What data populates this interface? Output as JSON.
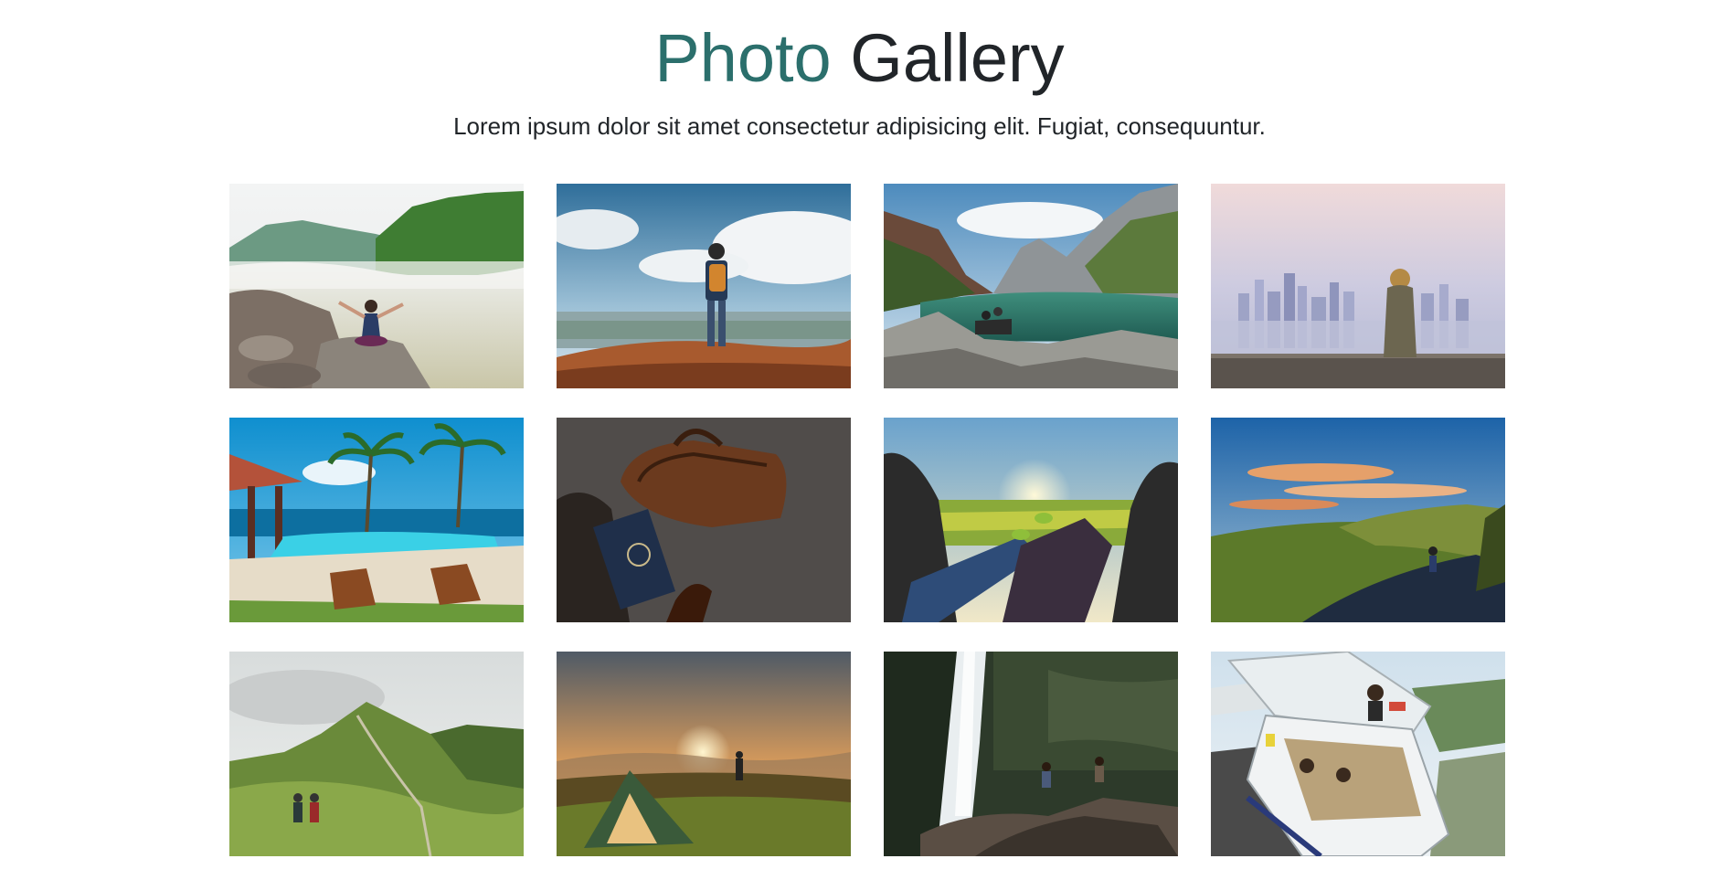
{
  "header": {
    "title_accent": "Photo",
    "title_rest": " Gallery",
    "subtitle": "Lorem ipsum dolor sit amet consectetur adipisicing elit. Fugiat, consequuntur."
  },
  "colors": {
    "accent": "#2b6f6c",
    "text": "#212529",
    "background": "#ffffff"
  },
  "gallery": {
    "photos": [
      {
        "name": "photo-river-meditation"
      },
      {
        "name": "photo-hiker-cliff"
      },
      {
        "name": "photo-mountain-lake"
      },
      {
        "name": "photo-city-view"
      },
      {
        "name": "photo-tropical-pool"
      },
      {
        "name": "photo-passport-bag"
      },
      {
        "name": "photo-car-trunk-sunset"
      },
      {
        "name": "photo-road-cyclist"
      },
      {
        "name": "photo-green-mountain-hikers"
      },
      {
        "name": "photo-tent-sunrise"
      },
      {
        "name": "photo-waterfall"
      },
      {
        "name": "photo-van-friends"
      }
    ]
  }
}
